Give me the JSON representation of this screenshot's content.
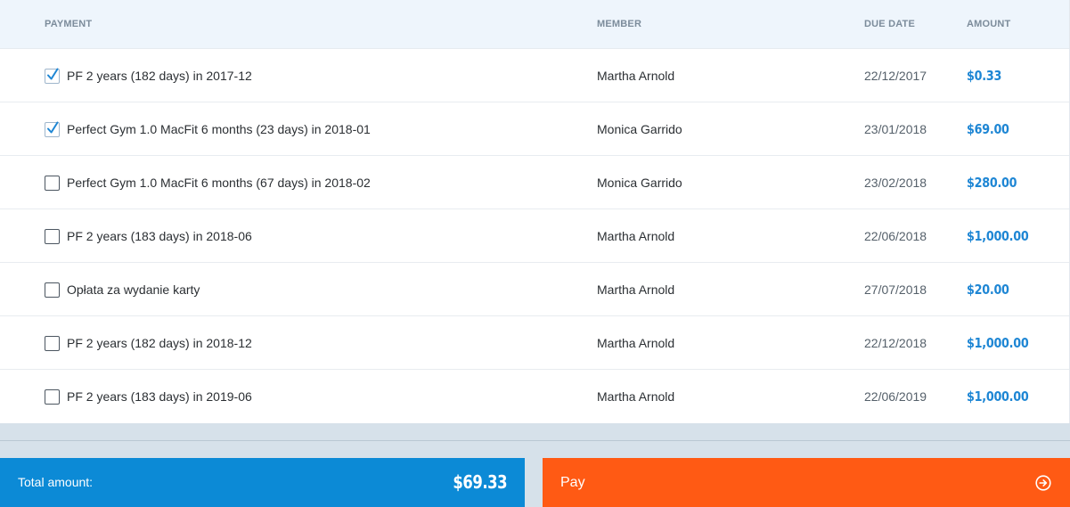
{
  "table": {
    "headers": {
      "payment": "PAYMENT",
      "member": "MEMBER",
      "due_date": "DUE DATE",
      "amount": "AMOUNT"
    },
    "rows": [
      {
        "checked": true,
        "payment": "PF 2 years (182 days) in 2017-12",
        "member": "Martha Arnold",
        "due_date": "22/12/2017",
        "amount": "$0.33"
      },
      {
        "checked": true,
        "payment": "Perfect Gym 1.0 MacFit 6 months (23 days) in 2018-01",
        "member": "Monica Garrido",
        "due_date": "23/01/2018",
        "amount": "$69.00"
      },
      {
        "checked": false,
        "payment": "Perfect Gym 1.0 MacFit 6 months (67 days) in 2018-02",
        "member": "Monica Garrido",
        "due_date": "23/02/2018",
        "amount": "$280.00"
      },
      {
        "checked": false,
        "payment": "PF 2 years (183 days) in 2018-06",
        "member": "Martha Arnold",
        "due_date": "22/06/2018",
        "amount": "$1,000.00"
      },
      {
        "checked": false,
        "payment": "Opłata za wydanie karty",
        "member": "Martha Arnold",
        "due_date": "27/07/2018",
        "amount": "$20.00"
      },
      {
        "checked": false,
        "payment": "PF 2 years (182 days) in 2018-12",
        "member": "Martha Arnold",
        "due_date": "22/12/2018",
        "amount": "$1,000.00"
      },
      {
        "checked": false,
        "payment": "PF 2 years (183 days) in 2019-06",
        "member": "Martha Arnold",
        "due_date": "22/06/2019",
        "amount": "$1,000.00"
      }
    ]
  },
  "footer": {
    "total_label": "Total amount:",
    "total_value": "$69.33",
    "pay_label": "Pay",
    "pay_icon": "arrow-circle-right-icon"
  },
  "colors": {
    "header_bg": "#eef5fc",
    "amount_text": "#1e86d4",
    "total_bar": "#0c8ad6",
    "pay_button": "#ff5a14",
    "page_bg": "#d6e1ea"
  }
}
